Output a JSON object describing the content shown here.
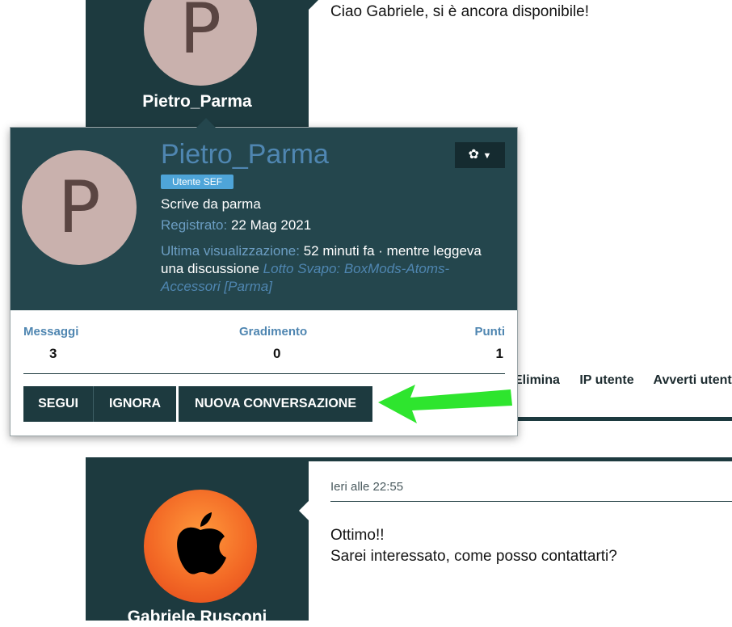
{
  "post1": {
    "avatar_letter": "P",
    "username": "Pietro_Parma",
    "message": "Ciao Gabriele, si è ancora disponibile!"
  },
  "post_actions": [
    "Elimina",
    "IP utente",
    "Avverti utente"
  ],
  "profile_card": {
    "avatar_letter": "P",
    "name": "Pietro_Parma",
    "badge": "Utente SEF",
    "location": "Scrive da parma",
    "registered_label": "Registrato:",
    "registered_value": "22 Mag 2021",
    "last_seen_label": "Ultima visualizzazione:",
    "last_seen_value": "52 minuti fa · mentre leggeva una discussione",
    "thread_link": "Lotto Svapo: BoxMods-Atoms-Accessori [Parma]",
    "stats": {
      "messages_label": "Messaggi",
      "messages_value": "3",
      "rating_label": "Gradimento",
      "rating_value": "0",
      "points_label": "Punti",
      "points_value": "1"
    },
    "buttons": {
      "follow": "SEGUI",
      "ignore": "IGNORA",
      "new_conversation": "NUOVA CONVERSAZIONE"
    },
    "gear_icon": "gear-icon",
    "accent_color": "#4f86b1",
    "header_color": "#24464d"
  },
  "annotation": {
    "arrow_color": "#2ee52e",
    "icon": "green-arrow-icon"
  },
  "post2": {
    "date": "Ieri alle 22:55",
    "line1": "Ottimo!!",
    "line2": "Sarei interessato, come posso contattarti?",
    "username": "Gabriele Rusconi",
    "avatar_icon": "apple-logo-icon"
  }
}
